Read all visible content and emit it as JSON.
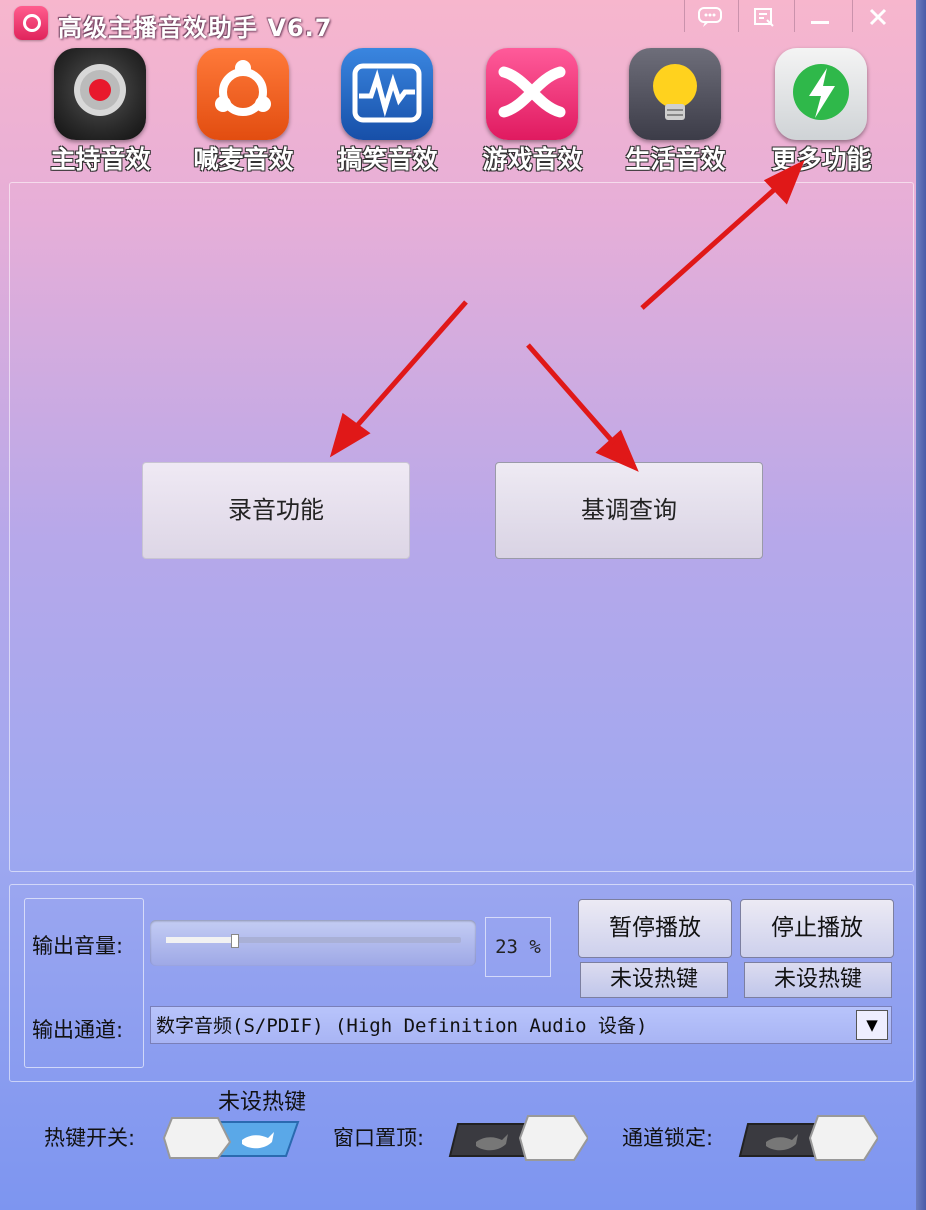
{
  "window": {
    "title": "高级主播音效助手 V6.7"
  },
  "nav": [
    {
      "label": "主持音效",
      "icon": "record-icon"
    },
    {
      "label": "喊麦音效",
      "icon": "ubuntu-icon"
    },
    {
      "label": "搞笑音效",
      "icon": "waveform-icon"
    },
    {
      "label": "游戏音效",
      "icon": "x-icon"
    },
    {
      "label": "生活音效",
      "icon": "bulb-icon"
    },
    {
      "label": "更多功能",
      "icon": "bolt-icon"
    }
  ],
  "main": {
    "record_label": "录音功能",
    "key_query_label": "基调查询"
  },
  "controls": {
    "volume_label": "输出音量:",
    "volume_percent": 23,
    "volume_text": "23 %",
    "pause_label": "暂停播放",
    "stop_label": "停止播放",
    "pause_hotkey": "未设热键",
    "stop_hotkey": "未设热键",
    "channel_label": "输出通道:",
    "channel_value": "数字音频(S/PDIF) (High Definition Audio 设备)"
  },
  "footer": {
    "hotkey_switch_label": "热键开关:",
    "hotkey_status": "未设热键",
    "topmost_label": "窗口置顶:",
    "channel_lock_label": "通道锁定:"
  },
  "colors": {
    "arrow": "#e01818",
    "accent": "#5aa8e8"
  }
}
